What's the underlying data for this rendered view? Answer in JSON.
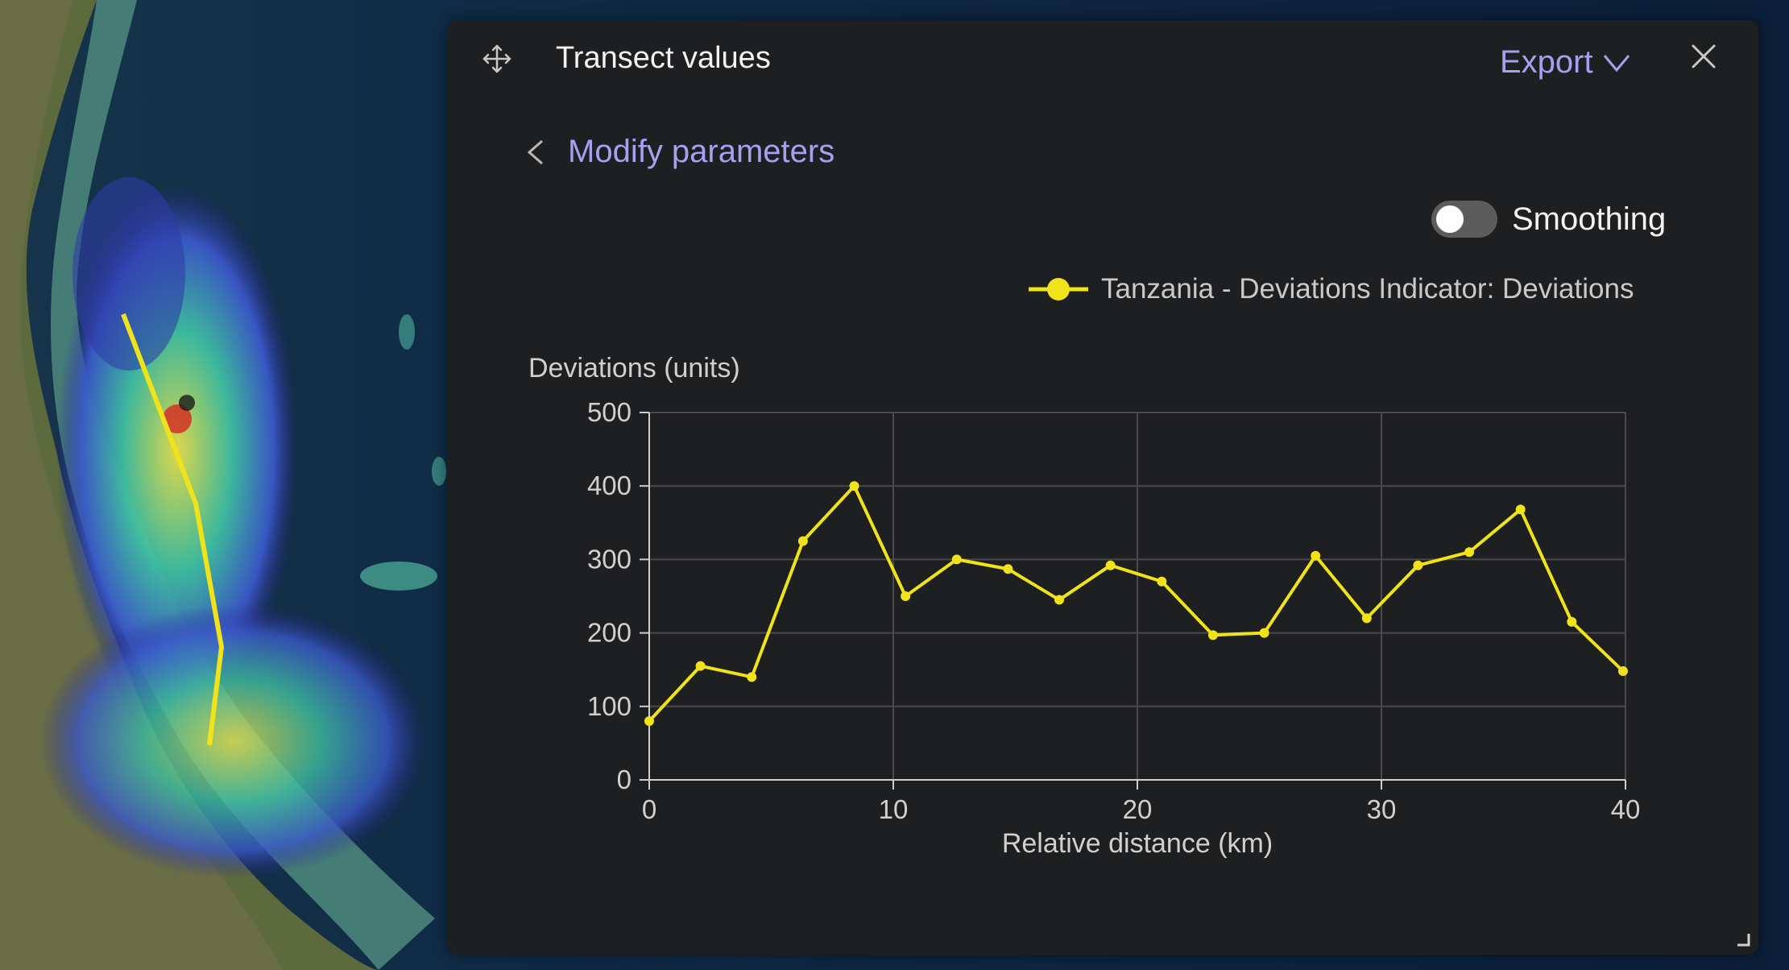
{
  "panel": {
    "title": "Transect values",
    "export_label": "Export",
    "modify_label": "Modify parameters",
    "smoothing_label": "Smoothing",
    "smoothing_on": false,
    "legend_label": "Tanzania - Deviations Indicator: Deviations"
  },
  "colors": {
    "panel_bg": "#1e1f21",
    "accent": "#a99ff0",
    "series": "#f0e31a",
    "grid": "#4a4a4d"
  },
  "icons": [
    "move-icon",
    "chevron-down-icon",
    "close-icon",
    "chevron-left-icon",
    "resize-handle-icon"
  ],
  "chart_data": {
    "type": "line",
    "title": "",
    "ylabel": "Deviations (units)",
    "xlabel": "Relative distance (km)",
    "xlim": [
      0,
      40
    ],
    "ylim": [
      0,
      500
    ],
    "xticks": [
      0,
      10,
      20,
      30,
      40
    ],
    "yticks": [
      0,
      100,
      200,
      300,
      400,
      500
    ],
    "grid": true,
    "legend_position": "top-right",
    "series": [
      {
        "name": "Tanzania - Deviations Indicator: Deviations",
        "color": "#f0e31a",
        "x": [
          0,
          2.1,
          4.2,
          6.3,
          8.4,
          10.5,
          12.6,
          14.7,
          16.8,
          18.9,
          21,
          23.1,
          25.2,
          27.3,
          29.4,
          31.5,
          33.6,
          35.7,
          37.8,
          39.9
        ],
        "y": [
          80,
          155,
          140,
          325,
          400,
          250,
          300,
          287,
          245,
          292,
          270,
          197,
          200,
          305,
          220,
          292,
          310,
          368,
          215,
          148
        ]
      }
    ]
  }
}
